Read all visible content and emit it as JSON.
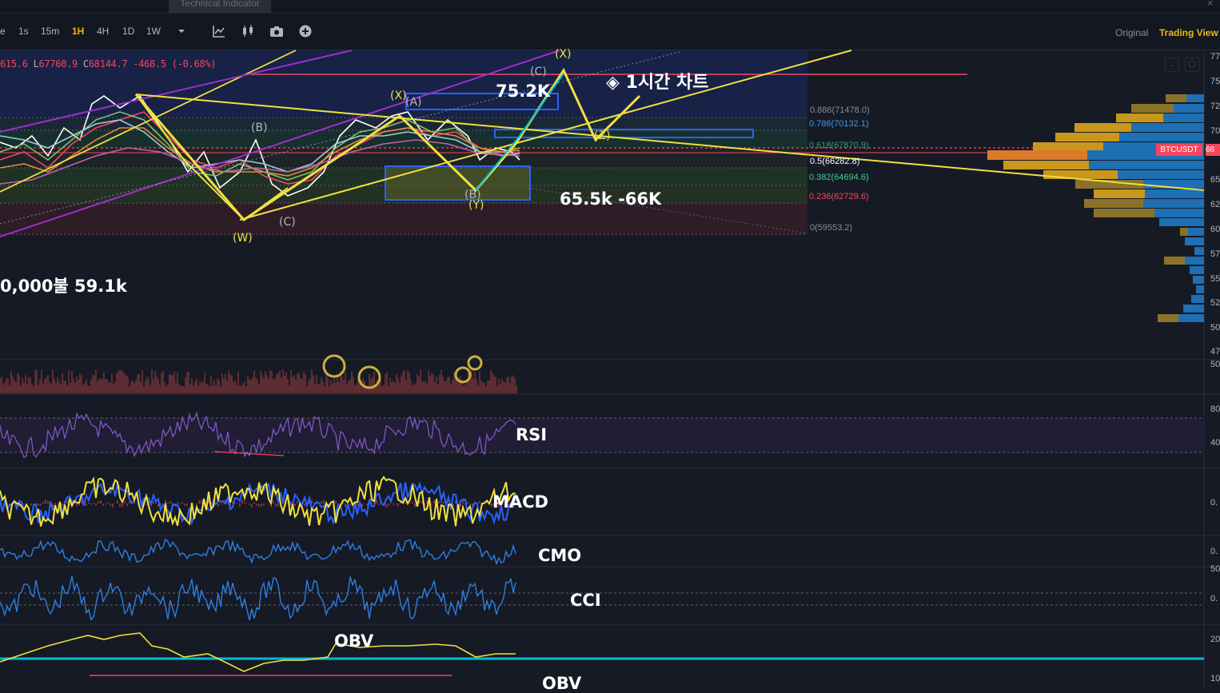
{
  "toolbar": {
    "tooltip": "Technical Indicator",
    "timeframes": [
      {
        "label": "e",
        "active": false
      },
      {
        "label": "1s",
        "active": false
      },
      {
        "label": "15m",
        "active": false
      },
      {
        "label": "1H",
        "active": true
      },
      {
        "label": "4H",
        "active": false
      },
      {
        "label": "1D",
        "active": false
      },
      {
        "label": "1W",
        "active": false
      }
    ],
    "icons": [
      "chevron-down-icon",
      "indicator-icon",
      "candle-type-icon",
      "camera-icon",
      "add-icon"
    ],
    "view_original": "Original",
    "view_tradingview": "Trading View",
    "close": "×"
  },
  "ohlc": {
    "high_fragment": "615.6",
    "low_label": "L",
    "low": "67760.9",
    "close_label": "C",
    "close": "68144.7",
    "change": "-468.5",
    "change_pct": "(-0.68%)"
  },
  "fib_levels": [
    {
      "label": "0.886(71478.0)",
      "color": "#848e9c"
    },
    {
      "label": "0.786(70132.1)",
      "color": "#3d9bf0"
    },
    {
      "label": "0.618(67870.9)",
      "color": "#21a672"
    },
    {
      "label": "0.5(66282.8)",
      "color": "#ffffff"
    },
    {
      "label": "0.382(64694.6)",
      "color": "#3ed28c"
    },
    {
      "label": "0.236(62729.6)",
      "color": "#f6465d"
    },
    {
      "label": "0(59553.2)",
      "color": "#848e9c"
    }
  ],
  "price_axis": [
    "77",
    "75",
    "72",
    "70",
    "68",
    "65",
    "62",
    "60",
    "57",
    "55",
    "52",
    "50",
    "47"
  ],
  "symbol_badge": "BTCUSDT",
  "symbol_badge_price": "68",
  "annotations": {
    "hourly_chart": "◈ 1시간 차트",
    "target_high": "75.2K",
    "support_zone": "65.5k -66K",
    "low_target": "0,000불 59.1k"
  },
  "wave_labels": {
    "a": "(A)",
    "b": "(B)",
    "c": "(C)",
    "w": "(W)",
    "x1": "(X)",
    "b2": "(B)",
    "y": "(Y)",
    "c2": "(C)",
    "x2": "(X)",
    "z": "(Z)"
  },
  "indicators": {
    "rsi": "RSI",
    "macd": "MACD",
    "cmo": "CMO",
    "cci": "CCI",
    "obv": "OBV",
    "obv2": "OBV"
  },
  "pane_axis": {
    "volume": "50",
    "rsi_top": "80",
    "rsi_bottom": "40",
    "macd": "0.",
    "cmo": "0.",
    "cci_top": "50",
    "cci": "0.",
    "obv_top": "20",
    "obv_bottom": "10"
  },
  "colors": {
    "background": "#161a25",
    "accent": "#f0b90b",
    "down": "#f6465d",
    "up": "#0ecb81",
    "wave_yellow": "#f0e040",
    "channel_purple": "#9b30c8",
    "rsi_purple": "#7e57c2",
    "indicator_blue": "#2962ff",
    "obv_cyan": "#00bcd4"
  }
}
